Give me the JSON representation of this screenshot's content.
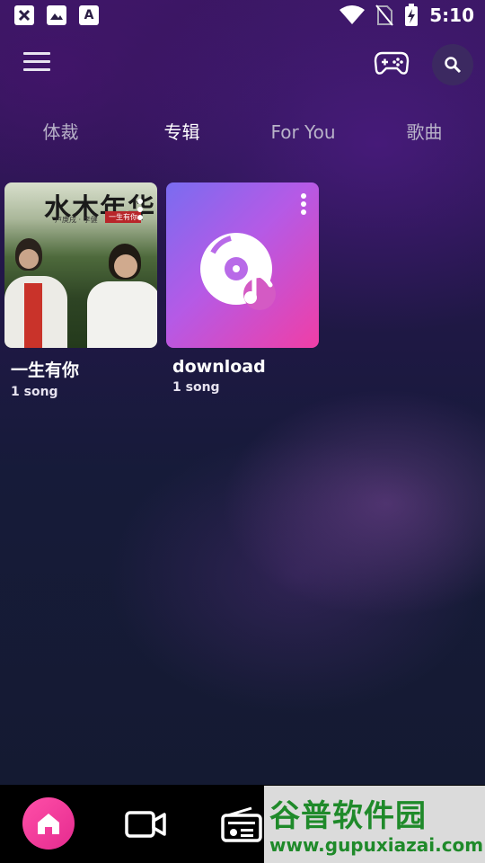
{
  "status_bar": {
    "time": "5:10",
    "left_icons": [
      "notification-blocked-icon",
      "image-icon",
      "font-app-icon"
    ],
    "right_icons": [
      "wifi-icon",
      "no-sim-icon",
      "battery-charging-icon"
    ]
  },
  "toolbar": {
    "menu_icon": "menu-icon",
    "game_icon": "gamepad-icon",
    "search_icon": "search-icon"
  },
  "tabs": [
    {
      "label": "体裁",
      "active": false
    },
    {
      "label": "专辑",
      "active": true
    },
    {
      "label": "For You",
      "active": false
    },
    {
      "label": "歌曲",
      "active": false
    }
  ],
  "albums": [
    {
      "title": "一生有你",
      "count": "1 song",
      "cover_text": "水木年华",
      "cover_sub": "卢庚戌 · 李健",
      "cover_tag": "一生有你"
    },
    {
      "title": "download",
      "count": "1 song",
      "cover_icon": "music-disc-icon"
    }
  ],
  "bottom_nav": {
    "items": [
      "home-icon",
      "video-icon",
      "radio-icon"
    ]
  },
  "watermark": {
    "title": "谷普软件园",
    "url": "www.gupuxiazai.com"
  },
  "colors": {
    "accent_pink": "#f0359a",
    "tab_active": "#ffffff",
    "tab_inactive": "#b9b3c9"
  }
}
